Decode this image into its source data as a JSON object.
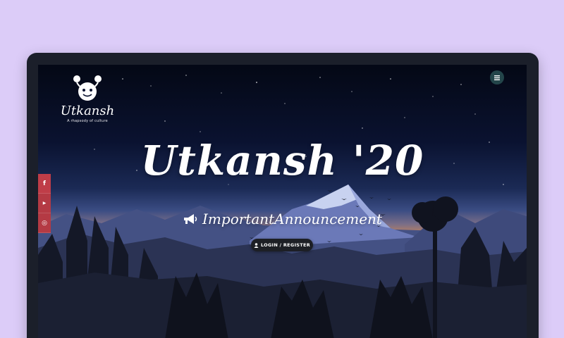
{
  "logo": {
    "name": "Utkansh",
    "tagline": "A rhapsody of culture"
  },
  "hero": {
    "title": "Utkansh '20",
    "announcement": "ImportantAnnouncement"
  },
  "login_button": {
    "label": "LOGIN / REGISTER"
  },
  "social": [
    {
      "name": "facebook",
      "glyph": "f"
    },
    {
      "name": "youtube",
      "glyph": "▶"
    },
    {
      "name": "instagram",
      "glyph": "◎"
    }
  ],
  "colors": {
    "page_bg": "#dcccf8",
    "frame": "#1b1f2a",
    "social_red": "#b43a44",
    "menu_button": "#23454a",
    "sunset_orange": "#f4a65a"
  }
}
